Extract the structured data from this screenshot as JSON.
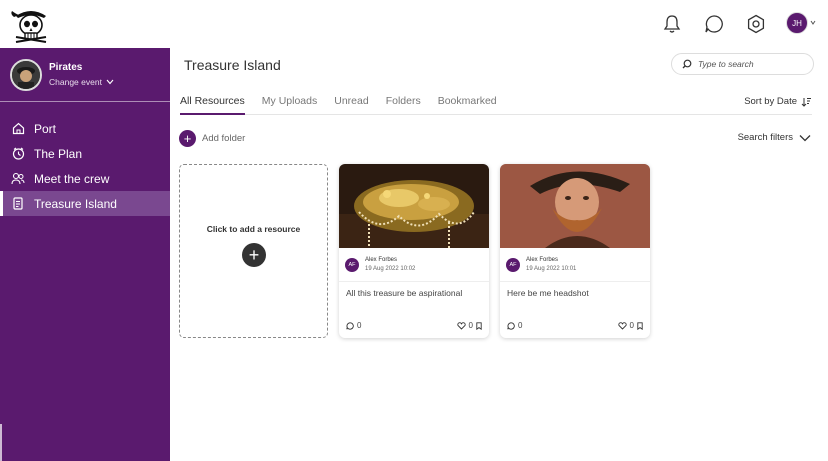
{
  "header": {
    "icons": [
      "skull-logo",
      "bell-icon",
      "chat-icon",
      "settings-icon"
    ],
    "user_initials": "JH"
  },
  "sidebar": {
    "event_name": "Pirates",
    "change_event_label": "Change event",
    "items": [
      {
        "label": "Port",
        "icon": "home-icon",
        "active": false
      },
      {
        "label": "The Plan",
        "icon": "calendar-icon",
        "active": false
      },
      {
        "label": "Meet the crew",
        "icon": "people-icon",
        "active": false
      },
      {
        "label": "Treasure Island",
        "icon": "document-icon",
        "active": true
      }
    ]
  },
  "main": {
    "title": "Treasure Island",
    "search_placeholder": "Type to search",
    "tabs": [
      {
        "label": "All Resources",
        "active": true
      },
      {
        "label": "My Uploads",
        "active": false
      },
      {
        "label": "Unread",
        "active": false
      },
      {
        "label": "Folders",
        "active": false
      },
      {
        "label": "Bookmarked",
        "active": false
      }
    ],
    "sort_label": "Sort by Date",
    "add_folder_label": "Add folder",
    "search_filters_label": "Search filters",
    "add_resource_label": "Click to add a resource",
    "cards": [
      {
        "author": "Alex Forbes",
        "initials": "AF",
        "date": "19 Aug 2022 10:02",
        "caption": "All this treasure be aspirational",
        "comments": "0",
        "likes": "0",
        "image": "treasure-chest"
      },
      {
        "author": "Alex Forbes",
        "initials": "AF",
        "date": "19 Aug 2022 10:01",
        "caption": "Here be me headshot",
        "comments": "0",
        "likes": "0",
        "image": "pirate-headshot"
      }
    ]
  },
  "colors": {
    "brand_purple": "#5a1a6e",
    "active_item": "#7a4890"
  }
}
